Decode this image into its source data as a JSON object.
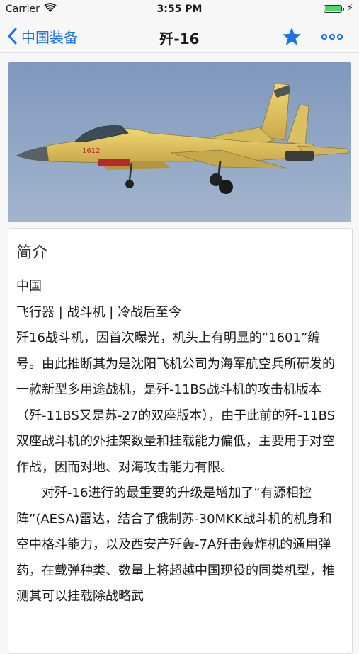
{
  "status_bar": {
    "carrier": "Carrier",
    "time": "3:55 PM",
    "battery_level": 1.0
  },
  "nav": {
    "back_label": "中国装备",
    "title": "歼-16",
    "star_icon": "star-icon",
    "more_icon": "more-icon",
    "accent_color": "#1a73e8"
  },
  "hero": {
    "aircraft_number": "1612"
  },
  "intro": {
    "section_title": "简介",
    "country": "中国",
    "category": "飞行器 | 战斗机 | 冷战后至今",
    "paragraph1": "歼16战斗机，因首次曝光，机头上有明显的“1601”编号。由此推断其为是沈阳飞机公司为海军航空兵所研发的一款新型多用途战机，是歼-11BS战斗机的攻击机版本（歼-11BS又是苏-27的双座版本），由于此前的歼-11BS双座战斗机的外挂架数量和挂载能力偏低，主要用于对空作战，因而对地、对海攻击能力有限。",
    "paragraph2": "对歼-16进行的最重要的升级是增加了“有源相控阵”(AESA)雷达，结合了俄制苏-30MKK战斗机的机身和空中格斗能力，以及西安产歼轰-7A歼击轰炸机的通用弹药，在载弹种类、数量上将超越中国现役的同类机型，推测其可以挂载除战略武"
  }
}
